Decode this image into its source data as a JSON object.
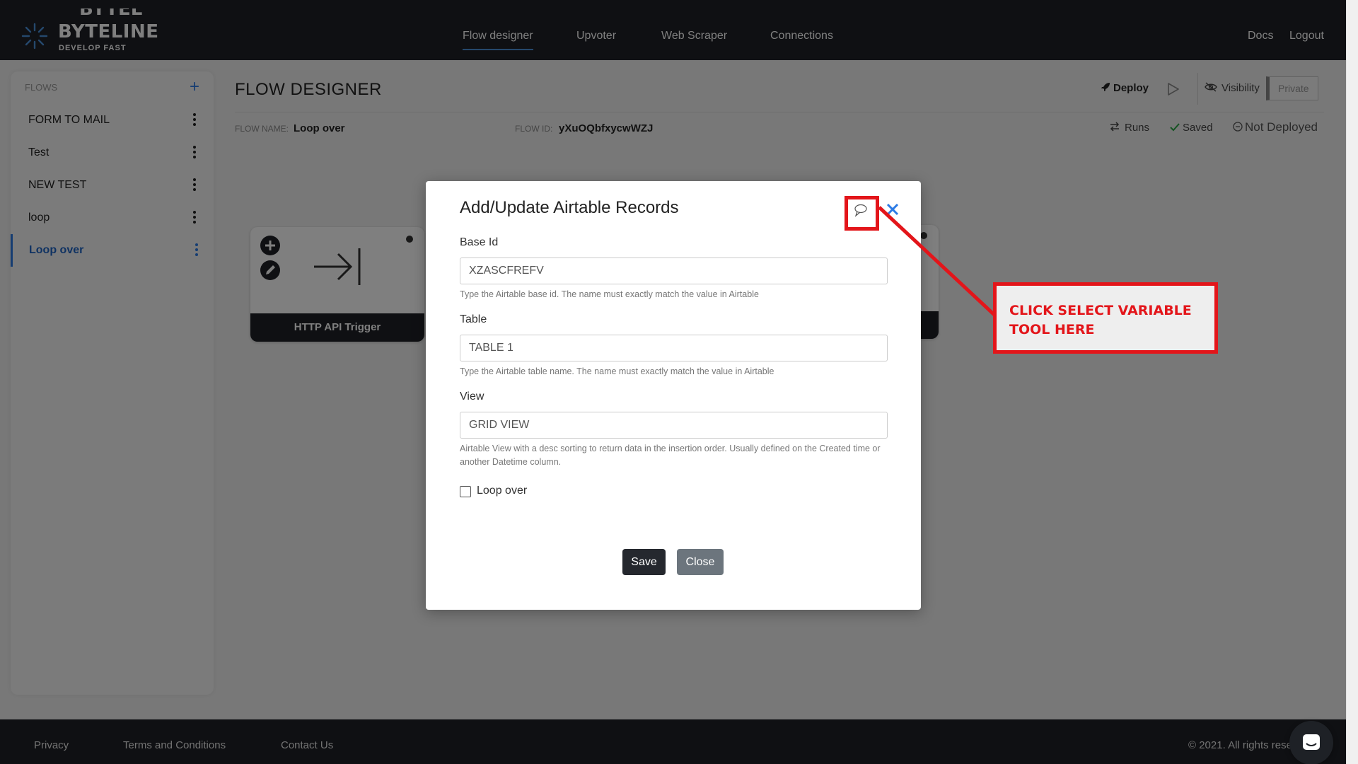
{
  "app": {
    "brand_name": "BYTELINE",
    "brand_tagline": "DEVELOP FAST",
    "brand_cut_text": "BYTELINE"
  },
  "nav": {
    "links": [
      "Flow designer",
      "Upvoter",
      "Web Scraper",
      "Connections"
    ],
    "active": "Flow designer",
    "right": [
      "Docs",
      "Logout"
    ]
  },
  "sidebar": {
    "heading": "FLOWS",
    "add_icon": "plus-icon",
    "items": [
      {
        "label": "FORM TO MAIL"
      },
      {
        "label": "Test"
      },
      {
        "label": "NEW TEST"
      },
      {
        "label": "loop"
      },
      {
        "label": "Loop over"
      }
    ],
    "active_item": "Loop over"
  },
  "page": {
    "title": "FLOW DESIGNER",
    "deploy_label": "Deploy",
    "visibility_label": "Visibility",
    "private_label": "Private",
    "flow_name_label": "FLOW NAME:",
    "flow_name_value": "Loop over",
    "flow_id_label": "FLOW ID:",
    "flow_id_value": "yXuOQbfxycwWZJ",
    "runs_label": "Runs",
    "saved_label": "Saved",
    "status_label": "Not Deployed"
  },
  "canvas": {
    "nodes": [
      {
        "label": "HTTP API Trigger",
        "icon": "arrow-to-line-icon"
      }
    ]
  },
  "modal": {
    "title": "Add/Update Airtable Records",
    "fields": [
      {
        "label": "Base Id",
        "value": "XZASCFREFV",
        "help": "Type the Airtable base id. The name must exactly match the value in Airtable"
      },
      {
        "label": "Table",
        "value": "TABLE 1",
        "help": "Type the Airtable table name. The name must exactly match the value in Airtable"
      },
      {
        "label": "View",
        "value": "GRID VIEW",
        "help": "Airtable View with a desc sorting to return data in the insertion order. Usually defined on the Created time or another Datetime column."
      }
    ],
    "checkbox_label": "Loop over",
    "checkbox_checked": false,
    "save_label": "Save",
    "close_label": "Close"
  },
  "annotation": {
    "text": "CLICK SELECT VARIABLE TOOL HERE",
    "color": "#e3151a"
  },
  "footer": {
    "links": [
      "Privacy",
      "Terms and Conditions",
      "Contact Us"
    ],
    "copyright": "© 2021. All rights rese"
  },
  "colors": {
    "nav_bg": "#1e2126",
    "accent_blue": "#2c7be5",
    "annotation_red": "#e3151a"
  }
}
